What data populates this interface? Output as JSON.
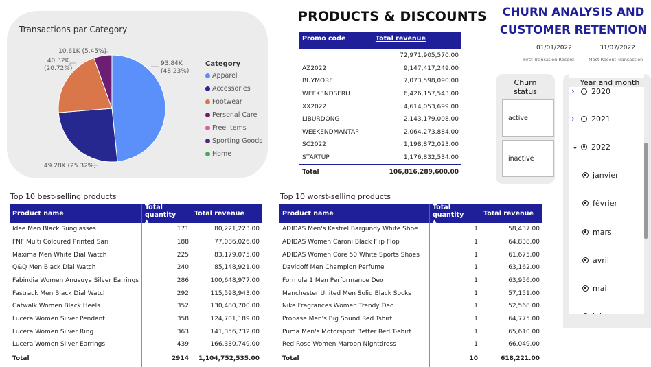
{
  "pie": {
    "title": "Transactions par Category",
    "legend_title": "Category",
    "labels": {
      "apparel": [
        "93.84K",
        "(48.23%)"
      ],
      "accessories": "49.28K (25.32%)",
      "footwear": [
        "40.32K",
        "(20.72%)"
      ],
      "personal_care": "10.61K (5.45%)"
    },
    "legend": [
      {
        "name": "Apparel",
        "color": "#5b8ff9"
      },
      {
        "name": "Accessories",
        "color": "#26278f"
      },
      {
        "name": "Footwear",
        "color": "#d9774a"
      },
      {
        "name": "Personal Care",
        "color": "#6b1e72"
      },
      {
        "name": "Free Items",
        "color": "#e15aa8"
      },
      {
        "name": "Sporting Goods",
        "color": "#4b2a75"
      },
      {
        "name": "Home",
        "color": "#4aa957"
      }
    ]
  },
  "chart_data": {
    "type": "pie",
    "title": "Transactions par Category",
    "categories": [
      "Apparel",
      "Accessories",
      "Footwear",
      "Personal Care"
    ],
    "values": [
      93840,
      49280,
      40320,
      10610
    ],
    "percentages": [
      48.23,
      25.32,
      20.72,
      5.45
    ]
  },
  "products": {
    "title": "PRODUCTS & DISCOUNTS",
    "headers": [
      "Promo code",
      "Total revenue"
    ],
    "rows": [
      [
        "",
        "72,971,905,570.00"
      ],
      [
        "AZ2022",
        "9,147,417,249.00"
      ],
      [
        "BUYMORE",
        "7,073,598,090.00"
      ],
      [
        "WEEKENDSERU",
        "6,426,157,543.00"
      ],
      [
        "XX2022",
        "4,614,053,699.00"
      ],
      [
        "LIBURDONG",
        "2,143,179,008.00"
      ],
      [
        "WEEKENDMANTAP",
        "2,064,273,884.00"
      ],
      [
        "SC2022",
        "1,198,872,023.00"
      ],
      [
        "STARTUP",
        "1,176,832,534.00"
      ]
    ],
    "total": [
      "Total",
      "106,816,289,600.00"
    ]
  },
  "best": {
    "title": "Top 10 best-selling products",
    "headers": [
      "Product name",
      "Total quantity",
      "Total revenue"
    ],
    "rows": [
      [
        "Idee Men Black Sunglasses",
        "171",
        "80,221,223.00"
      ],
      [
        "FNF Multi Coloured Printed Sari",
        "188",
        "77,086,026.00"
      ],
      [
        "Maxima Men White Dial Watch",
        "225",
        "83,179,075.00"
      ],
      [
        "Q&Q Men Black Dial Watch",
        "240",
        "85,148,921.00"
      ],
      [
        "Fabindia Women Anusuya Silver Earrings",
        "286",
        "100,648,977.00"
      ],
      [
        "Fastrack Men Black Dial Watch",
        "292",
        "115,598,943.00"
      ],
      [
        "Catwalk Women Black Heels",
        "352",
        "130,480,700.00"
      ],
      [
        "Lucera Women Silver Pendant",
        "358",
        "124,701,189.00"
      ],
      [
        "Lucera Women Silver Ring",
        "363",
        "141,356,732.00"
      ],
      [
        "Lucera Women Silver Earrings",
        "439",
        "166,330,749.00"
      ]
    ],
    "total": [
      "Total",
      "2914",
      "1,104,752,535.00"
    ]
  },
  "worst": {
    "title": "Top 10 worst-selling products",
    "headers": [
      "Product name",
      "Total quantity",
      "Total revenue"
    ],
    "rows": [
      [
        "ADIDAS Men's Kestrel Bargundy White Shoe",
        "1",
        "58,437.00"
      ],
      [
        "ADIDAS Women Caroni Black Flip Flop",
        "1",
        "64,838.00"
      ],
      [
        "ADIDAS Women Core 50 White Sports Shoes",
        "1",
        "61,675.00"
      ],
      [
        "Davidoff Men Champion Perfume",
        "1",
        "63,162.00"
      ],
      [
        "Formula 1 Men Performance Deo",
        "1",
        "63,956.00"
      ],
      [
        "Manchester United Men Solid Black Socks",
        "1",
        "57,151.00"
      ],
      [
        "Nike Fragrances Women Trendy Deo",
        "1",
        "52,568.00"
      ],
      [
        "Probase Men's Big Sound Red Tshirt",
        "1",
        "64,775.00"
      ],
      [
        "Puma Men's Motorsport Better Red T-shirt",
        "1",
        "65,610.00"
      ],
      [
        "Red Rose Women Maroon Nightdress",
        "1",
        "66,049.00"
      ]
    ],
    "total": [
      "Total",
      "10",
      "618,221.00"
    ]
  },
  "churn": {
    "title_line1": "CHURN ANALYSIS AND",
    "title_line2": "CUSTOMER RETENTION",
    "date1": "01/01/2022",
    "date1_caption": "First Transation Record",
    "date2": "31/07/2022",
    "date2_caption": "Most Recent Transaction",
    "status_title": "Churn status",
    "status_options": [
      "active",
      "inactive"
    ]
  },
  "year_slicer": {
    "title": "Year and month",
    "items": [
      {
        "label": "2020",
        "checked": false,
        "expand": true
      },
      {
        "label": "2021",
        "checked": false,
        "expand": true
      },
      {
        "label": "2022",
        "checked": true,
        "expand": true,
        "expanded": true
      },
      {
        "label": "janvier",
        "checked": true
      },
      {
        "label": "février",
        "checked": true
      },
      {
        "label": "mars",
        "checked": true
      },
      {
        "label": "avril",
        "checked": true
      },
      {
        "label": "mai",
        "checked": true
      },
      {
        "label": "juin",
        "checked": true
      }
    ]
  }
}
